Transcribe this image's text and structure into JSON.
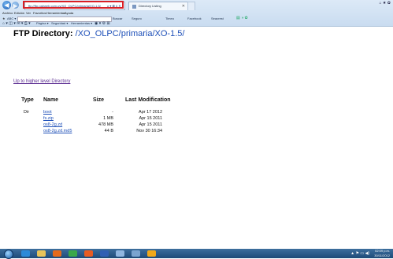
{
  "browser": {
    "address": "ftp://ftp.pairweb.com.uy/XO_OLPC/primaria/XO-1.5/",
    "address_suffix": "ρ ▾ ⊠ ¢ ✕",
    "tab_title": "Directory Listing",
    "tab_close": "✕",
    "window_controls": "⌂ ★ ✿",
    "menu": [
      "Archivo",
      "Edición",
      "Ver",
      "Favoritos",
      "Herramientas",
      "Ayuda"
    ],
    "favbar": [
      "ABC ▾",
      "Buscar",
      "Seguro",
      "Timeo",
      "Facebook",
      "Seacrest"
    ],
    "cmdbar": [
      "Página ▾",
      "Seguridad ▾",
      "Herramientas ▾"
    ]
  },
  "page": {
    "title_prefix": "FTP Directory:",
    "title_path": "/XO_OLPC/primaria/XO-1.5/",
    "up_link": "Up to higher level Directory",
    "columns": {
      "type": "Type",
      "name": "Name",
      "size": "Size",
      "modified": "Last Modification"
    },
    "rows": [
      {
        "type": "Dir",
        "name": "boot",
        "size": "-",
        "modified": "Apr 17 2012"
      },
      {
        "type": "",
        "name": "fs.zip",
        "size": "1 MB",
        "modified": "Apr 15 2011"
      },
      {
        "type": "",
        "name": "os8-2g.zd",
        "size": "478 MB",
        "modified": "Apr 15 2011"
      },
      {
        "type": "",
        "name": "os8-2g.zd.md5",
        "size": "44 B",
        "modified": "Nov 30 16:34"
      }
    ]
  },
  "taskbar": {
    "time": "02:09 p.m.",
    "date": "30/11/2012",
    "tray": "▲ ⚑ ▭ ◀)",
    "apps": [
      "ie",
      "explorer",
      "media",
      "chrome",
      "firefox",
      "word",
      "paint",
      "folder",
      "app"
    ]
  },
  "colors": {
    "link": "#1d4fb8",
    "visited": "#5a2b91",
    "highlight": "#d81f26",
    "taskbar": "#1e4a78"
  }
}
